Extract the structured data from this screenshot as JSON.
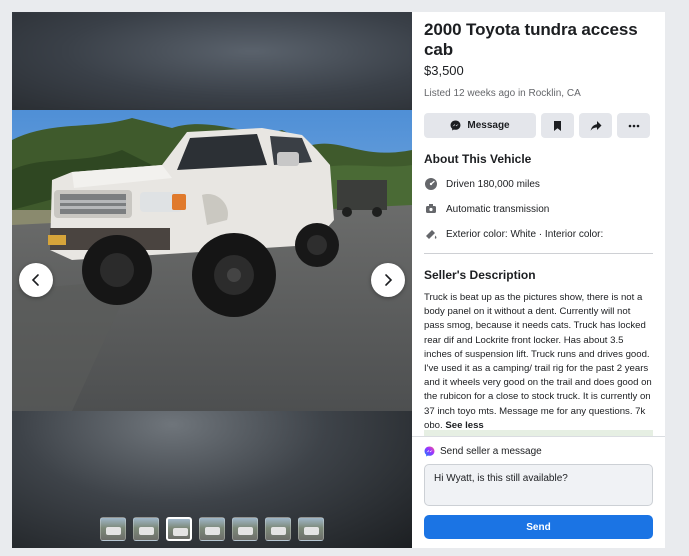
{
  "listing": {
    "title": "2000 Toyota tundra access cab",
    "price": "$3,500",
    "listed": "Listed 12 weeks ago in Rocklin, CA"
  },
  "actions": {
    "message_label": "Message",
    "icons": [
      "messenger-icon",
      "bookmark-icon",
      "share-icon",
      "more-icon"
    ]
  },
  "about": {
    "heading": "About This Vehicle",
    "specs": [
      {
        "icon": "speedometer-icon",
        "text": "Driven 180,000 miles"
      },
      {
        "icon": "transmission-icon",
        "text": "Automatic transmission"
      },
      {
        "icon": "paint-icon",
        "text": "Exterior color: White · Interior color:"
      }
    ]
  },
  "description": {
    "heading": "Seller's Description",
    "text": "Truck is beat up as the pictures show, there is not a body panel on it without a dent. Currently will not pass smog, because it needs cats. Truck has locked rear dif and Lockrite front locker. Has about 3.5 inches of suspension lift. Truck runs and drives good. I've used it as a camping/ trail rig for the past 2 years and it wheels very good on the trail and does good on the rubicon for a close to stock truck. It is currently on 37 inch toyo mts. Message me for any questions. 7k obo.",
    "see_less": "See less"
  },
  "send_message": {
    "heading": "Send seller a message",
    "input_value": "Hi Wyatt, is this still available?",
    "button_label": "Send"
  },
  "gallery": {
    "thumbnail_count": 7,
    "active_index": 2
  },
  "colors": {
    "accent": "#1b74e4",
    "button_bg": "#e4e6eb",
    "muted_text": "#65676b"
  }
}
